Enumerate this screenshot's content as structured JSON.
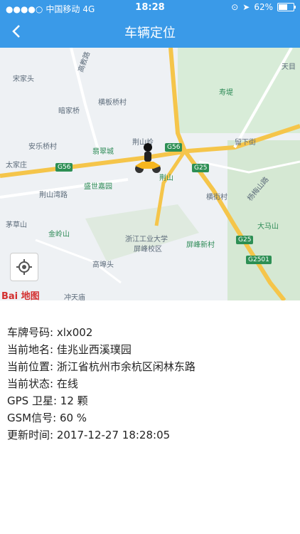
{
  "status": {
    "carrier": "中国移动",
    "network": "4G",
    "time": "18:28",
    "battery": "62%",
    "battery_level": 0.62
  },
  "nav": {
    "title": "车辆定位"
  },
  "map": {
    "labels": [
      "宋家头",
      "暗家桥",
      "横板桥村",
      "安乐桥村",
      "太家庄",
      "翡翠城",
      "盛世嘉园",
      "荆山湾路",
      "荆山岭",
      "荆山",
      "留下街",
      "寿堤",
      "横街村",
      "杨梅山路",
      "茅草山",
      "金岭山",
      "浙江工业大学",
      "屏峰校区",
      "屏峰新村",
      "大马山",
      "高埠头",
      "冲天庙",
      "天目",
      "高教路"
    ],
    "road_badges": [
      "G56",
      "G25",
      "G56",
      "G25",
      "G2501"
    ],
    "logo_text": "Bai 地图"
  },
  "info": {
    "plate_label": "车牌号码:",
    "plate": "xlx002",
    "place_label": "当前地名:",
    "place": "佳兆业西溪璞园",
    "location_label": "当前位置:",
    "location": "浙江省杭州市余杭区闲林东路",
    "state_label": "当前状态:",
    "state": "在线",
    "gps_label": "GPS 卫星:",
    "gps": "12 颗",
    "gsm_label": "GSM信号:",
    "gsm": "60 %",
    "update_label": "更新时间:",
    "update": "2017-12-27 18:28:05"
  }
}
